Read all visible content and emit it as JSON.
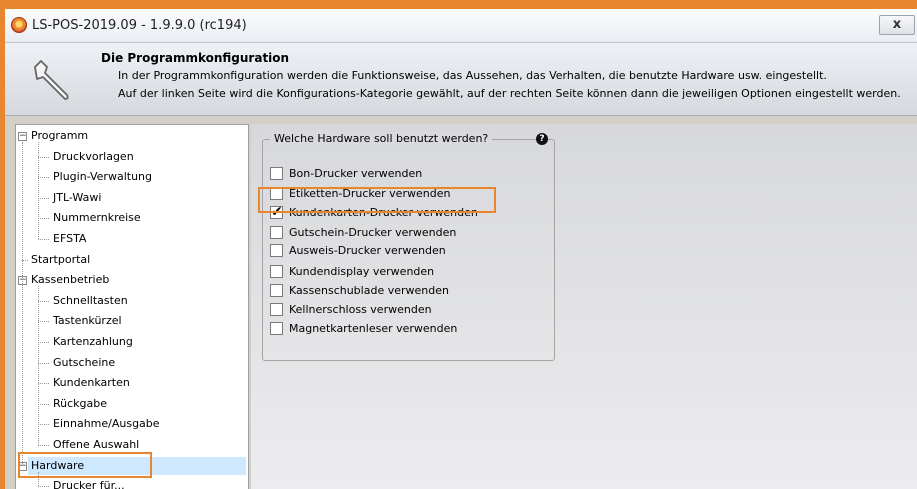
{
  "window": {
    "title": "LS-POS-2019.09 - 1.9.9.0 (rc194)",
    "close_label": "x"
  },
  "header": {
    "title": "Die Programmkonfiguration",
    "line1": "In der Programmkonfiguration werden die Funktionsweise, das Aussehen, das Verhalten, die benutzte Hardware usw. eingestellt.",
    "line2": "Auf der linken Seite wird die Konfigurations-Kategorie gewählt, auf der rechten Seite können dann die jeweiligen Optionen eingestellt werden."
  },
  "tree": {
    "items": [
      {
        "label": "Programm",
        "level": 0,
        "expander": "minus"
      },
      {
        "label": "Druckvorlagen",
        "level": 1
      },
      {
        "label": "Plugin-Verwaltung",
        "level": 1
      },
      {
        "label": "JTL-Wawi",
        "level": 1
      },
      {
        "label": "Nummernkreise",
        "level": 1
      },
      {
        "label": "EFSTA",
        "level": 1
      },
      {
        "label": "Startportal",
        "level": 0
      },
      {
        "label": "Kassenbetrieb",
        "level": 0,
        "expander": "minus"
      },
      {
        "label": "Schnelltasten",
        "level": 1
      },
      {
        "label": "Tastenkürzel",
        "level": 1
      },
      {
        "label": "Kartenzahlung",
        "level": 1
      },
      {
        "label": "Gutscheine",
        "level": 1
      },
      {
        "label": "Kundenkarten",
        "level": 1
      },
      {
        "label": "Rückgabe",
        "level": 1
      },
      {
        "label": "Einnahme/Ausgabe",
        "level": 1
      },
      {
        "label": "Offene Auswahl",
        "level": 1
      },
      {
        "label": "Hardware",
        "level": 0,
        "expander": "minus",
        "selected": true
      },
      {
        "label": "Drucker für...",
        "level": 1
      }
    ]
  },
  "hardware": {
    "group_title": "Welche Hardware soll benutzt werden?",
    "help_icon": "?",
    "options": [
      {
        "label": "Bon-Drucker verwenden",
        "checked": false
      },
      {
        "label": "Etiketten-Drucker verwenden",
        "checked": false
      },
      {
        "label": "Kundenkarten-Drucker verwenden",
        "checked": true
      },
      {
        "label": "Gutschein-Drucker verwenden",
        "checked": false
      },
      {
        "label": "Ausweis-Drucker verwenden",
        "checked": false
      },
      {
        "label": "Kundendisplay verwenden",
        "checked": false
      },
      {
        "label": "Kassenschublade verwenden",
        "checked": false
      },
      {
        "label": "Kellnerschloss verwenden",
        "checked": false
      },
      {
        "label": "Magnetkartenleser verwenden",
        "checked": false
      }
    ]
  },
  "colors": {
    "accent_highlight": "#e8862f",
    "selection": "#cde8ff"
  }
}
